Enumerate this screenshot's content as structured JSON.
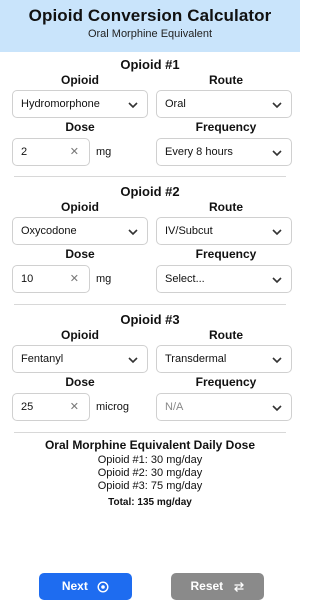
{
  "header": {
    "title": "Opioid Conversion Calculator",
    "subtitle": "Oral Morphine Equivalent"
  },
  "labels": {
    "opioid": "Opioid",
    "route": "Route",
    "dose": "Dose",
    "frequency": "Frequency"
  },
  "opioids": [
    {
      "title": "Opioid #1",
      "opioid": "Hydromorphone",
      "route": "Oral",
      "dose": "2",
      "unit": "mg",
      "frequency": "Every 8 hours"
    },
    {
      "title": "Opioid #2",
      "opioid": "Oxycodone",
      "route": "IV/Subcut",
      "dose": "10",
      "unit": "mg",
      "frequency": "Select..."
    },
    {
      "title": "Opioid #3",
      "opioid": "Fentanyl",
      "route": "Transdermal",
      "dose": "25",
      "unit": "microg",
      "frequency": "N/A"
    }
  ],
  "summary": {
    "title": "Oral Morphine Equivalent Daily Dose",
    "lines": [
      "Opioid #1: 30 mg/day",
      "Opioid #2: 30 mg/day",
      "Opioid #3: 75 mg/day"
    ],
    "total": "Total: 135 mg/day"
  },
  "buttons": {
    "next": "Next",
    "reset": "Reset"
  },
  "colors": {
    "header_bg": "#c9e4fb",
    "next_bg": "#1e6cf0",
    "reset_bg": "#8a8a8a"
  }
}
